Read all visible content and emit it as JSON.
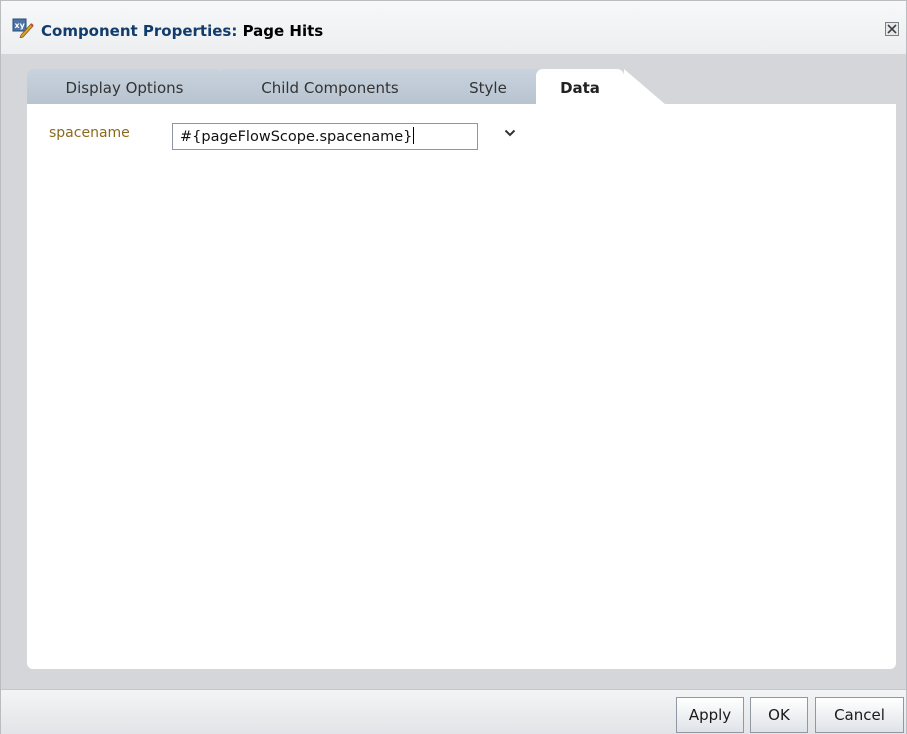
{
  "dialog": {
    "title_prefix": "Component Properties:",
    "title_name": "Page Hits",
    "icon": "xy-edit-icon",
    "close_icon": "close-icon"
  },
  "tabs": [
    {
      "label": "Display Options",
      "active": false
    },
    {
      "label": "Child Components",
      "active": false
    },
    {
      "label": "Style",
      "active": false
    },
    {
      "label": "Data",
      "active": true
    }
  ],
  "data_tab": {
    "field_label": "spacename",
    "field_value": "#{pageFlowScope.spacename}",
    "dropdown_icon": "chevron-down-icon"
  },
  "footer": {
    "apply_label": "Apply",
    "ok_label": "OK",
    "cancel_label": "Cancel"
  },
  "colors": {
    "title_text": "#123c6b",
    "field_label": "#8a6a1b",
    "inactive_tab": "#c1ccd7"
  }
}
